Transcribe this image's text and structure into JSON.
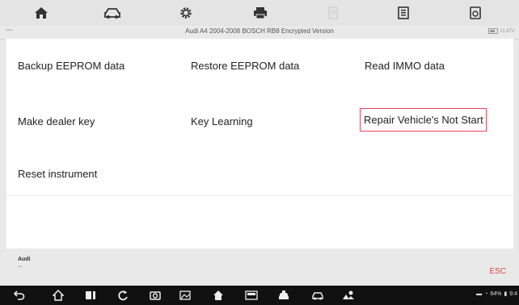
{
  "toolbar": {
    "icons": [
      "home-icon",
      "car-icon",
      "gear-icon",
      "printer-icon",
      "document-icon",
      "save-icon",
      "screenshot-icon"
    ]
  },
  "titlebar": {
    "title": "Audi A4 2004-2008 BOSCH RB8 Encrypted Version",
    "voltage": "11.87V"
  },
  "functions": {
    "backup": "Backup EEPROM data",
    "restore": "Restore EEPROM data",
    "read_immo": "Read IMMO data",
    "dealer_key": "Make dealer key",
    "key_learning": "Key Learning",
    "repair": "Repair Vehicle's Not Start",
    "reset_instrument": "Reset instrument"
  },
  "footer": {
    "make": "Audi",
    "esc": "ESC"
  },
  "navbar": {
    "battery": "64%",
    "time": "9:4"
  },
  "colors": {
    "highlight_border": "#e8445a",
    "esc": "#e0443a"
  }
}
